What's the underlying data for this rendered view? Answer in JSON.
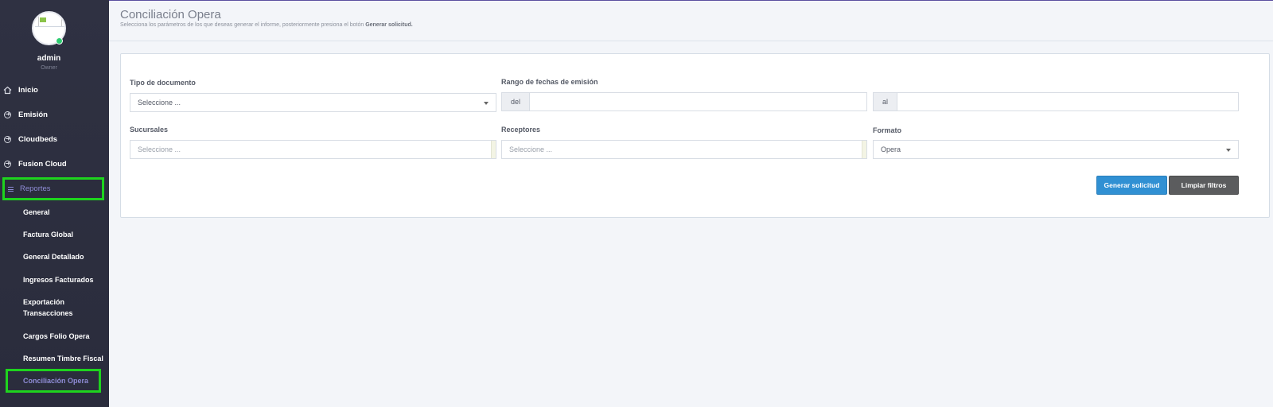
{
  "user": {
    "name": "admin",
    "role": "Owner"
  },
  "nav": {
    "items": [
      {
        "label": "Inicio",
        "icon": "home-icon"
      },
      {
        "label": "Emisión",
        "icon": "arrow-circle-icon"
      },
      {
        "label": "Cloudbeds",
        "icon": "arrow-circle-icon"
      },
      {
        "label": "Fusion Cloud",
        "icon": "arrow-circle-icon"
      }
    ],
    "reportes": {
      "label": "Reportes",
      "icon": "menu-bars-icon"
    },
    "sub_items": [
      "General",
      "Factura Global",
      "General Detallado",
      "Ingresos Facturados",
      "Exportación",
      "Transacciones",
      "Cargos Folio Opera",
      "Resumen Timbre Fiscal"
    ],
    "active_sub": "Conciliación Opera"
  },
  "header": {
    "title": "Conciliación Opera",
    "subtitle_prefix": "Selecciona los parámetros de los que deseas generar el informe, posteriormente presiona el botón ",
    "subtitle_bold": "Generar solicitud."
  },
  "form": {
    "tipo_label": "Tipo de documento",
    "tipo_value": "Seleccione ...",
    "rango_label": "Rango de fechas de emisión",
    "del_label": "del",
    "al_label": "al",
    "sucursales_label": "Sucursales",
    "sucursales_placeholder": "Seleccione ...",
    "receptores_label": "Receptores",
    "receptores_placeholder": "Seleccione ...",
    "formato_label": "Formato",
    "formato_value": "Opera"
  },
  "buttons": {
    "generar": "Generar solicitud",
    "limpiar": "Limpiar filtros"
  },
  "colors": {
    "sidebar": "#2f3142",
    "highlight": "#1ed31e",
    "primary": "#3090d3",
    "dark_button": "#5b5c5e"
  }
}
